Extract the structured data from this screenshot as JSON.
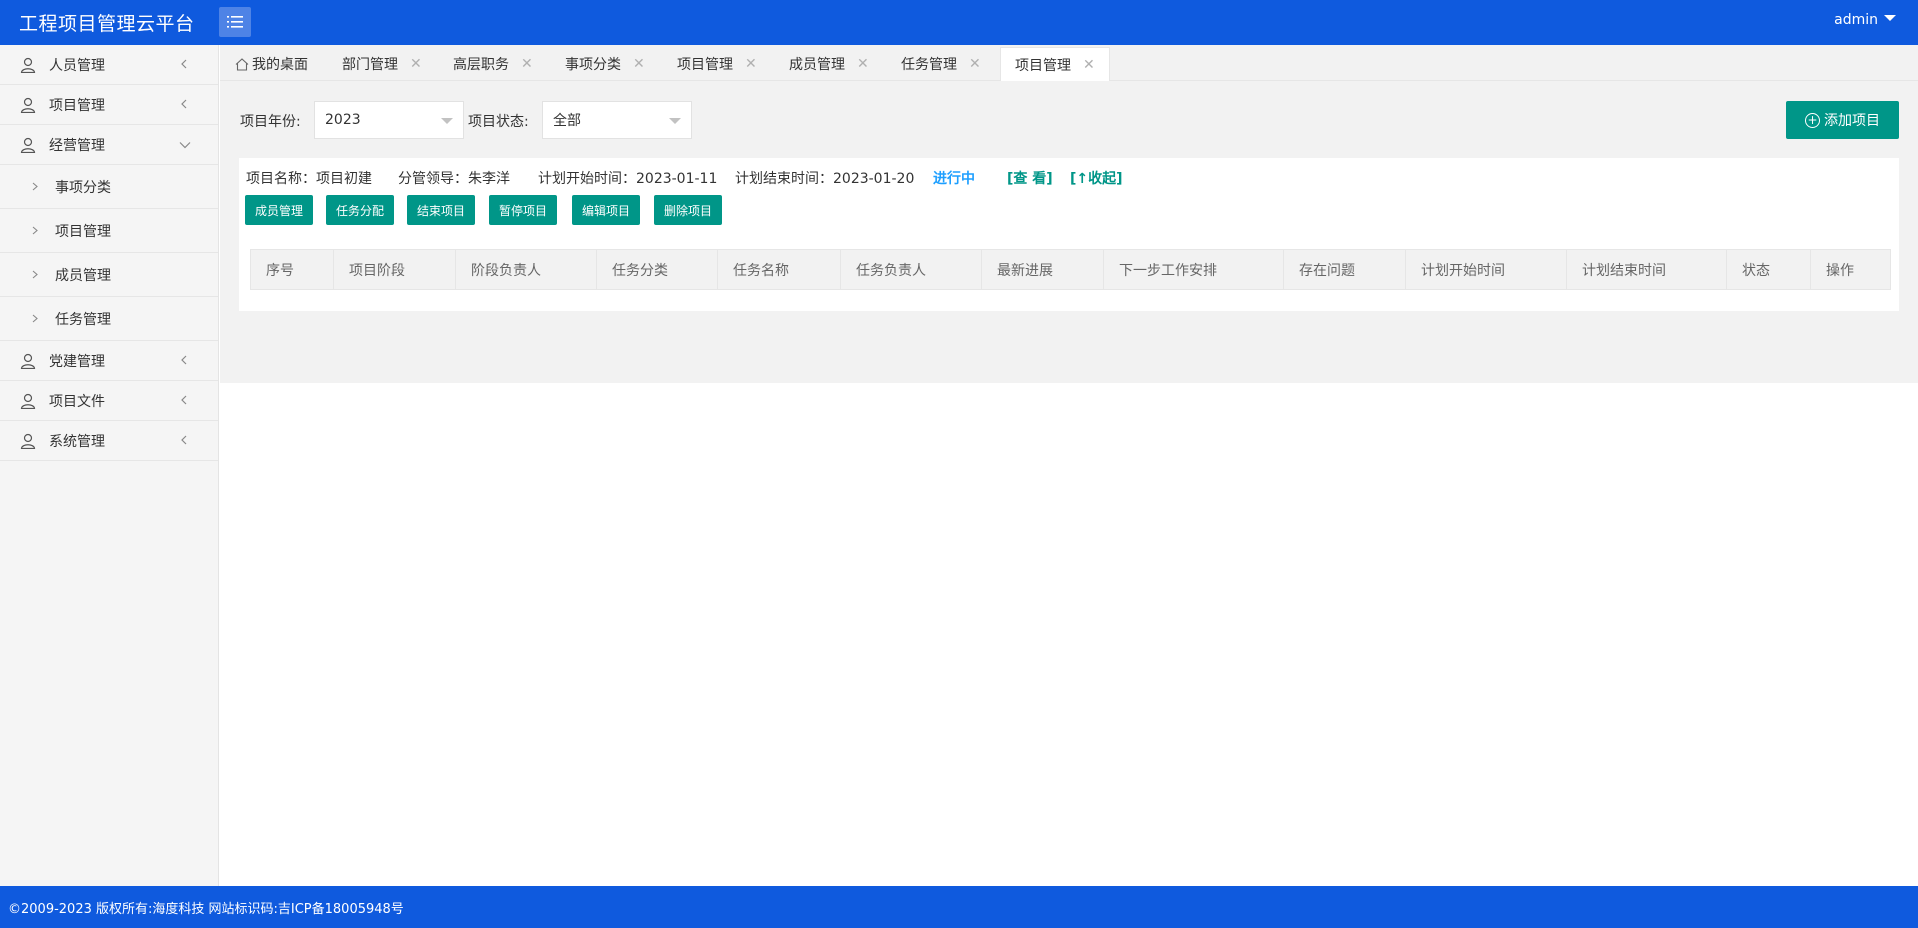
{
  "app": {
    "title": "工程项目管理云平台",
    "user": "admin"
  },
  "sidebar": {
    "items": [
      {
        "label": "人员管理"
      },
      {
        "label": "项目管理"
      },
      {
        "label": "经营管理"
      },
      {
        "label": "党建管理"
      },
      {
        "label": "项目文件"
      },
      {
        "label": "系统管理"
      }
    ],
    "subitems": [
      {
        "label": "事项分类"
      },
      {
        "label": "项目管理"
      },
      {
        "label": "成员管理"
      },
      {
        "label": "任务管理"
      }
    ]
  },
  "tabs": [
    {
      "label": "我的桌面"
    },
    {
      "label": "部门管理"
    },
    {
      "label": "高层职务"
    },
    {
      "label": "事项分类"
    },
    {
      "label": "项目管理"
    },
    {
      "label": "成员管理"
    },
    {
      "label": "任务管理"
    },
    {
      "label": "项目管理"
    }
  ],
  "filters": {
    "year_label": "项目年份:",
    "year_value": "2023",
    "status_label": "项目状态:",
    "status_value": "全部",
    "add_label": "添加项目"
  },
  "project": {
    "name": "项目名称：项目初建",
    "leader": "分管领导：朱李洋",
    "plan_start": "计划开始时间：2023-01-11",
    "plan_end": "计划结束时间：2023-01-20",
    "status": "进行中",
    "view_link": "[查 看]",
    "collapse_link": "[↑收起]",
    "actions": [
      "成员管理",
      "任务分配",
      "结束项目",
      "暂停项目",
      "编辑项目",
      "删除项目"
    ]
  },
  "table": {
    "headers": [
      "序号",
      "项目阶段",
      "阶段负责人",
      "任务分类",
      "任务名称",
      "任务负责人",
      "最新进展",
      "下一步工作安排",
      "存在问题",
      "计划开始时间",
      "计划结束时间",
      "状态",
      "操作"
    ]
  },
  "footer": {
    "text": "©2009-2023 版权所有:海度科技 网站标识码:吉ICP备18005948号"
  },
  "colors": {
    "header": "#0f5ade",
    "primary": "#009688",
    "status": "#1e9fff"
  }
}
